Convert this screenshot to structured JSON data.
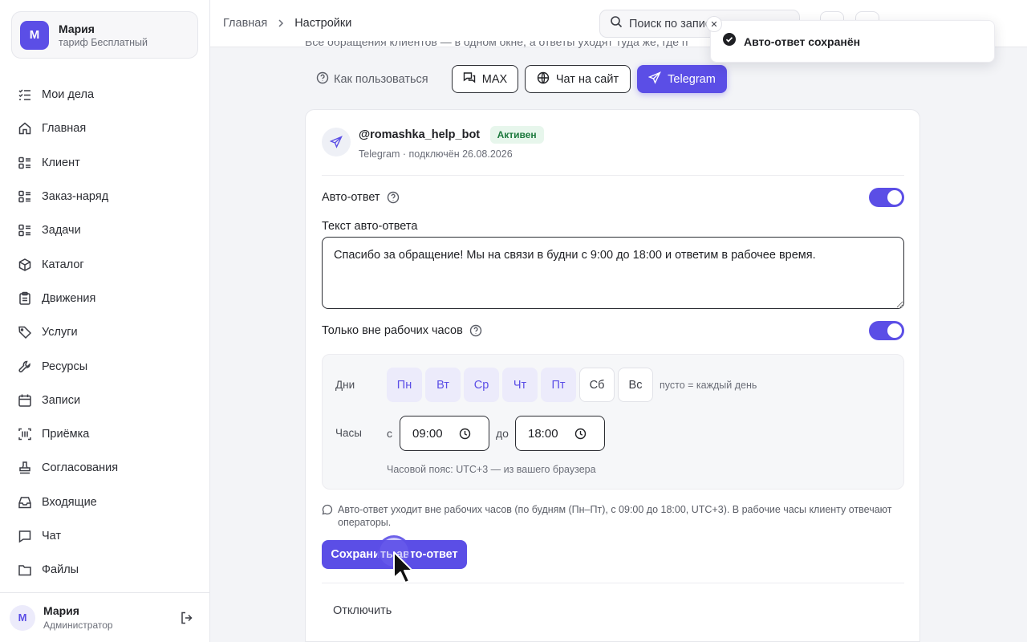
{
  "account": {
    "initial": "М",
    "name": "Мария",
    "plan": "тариф Бесплатный"
  },
  "nav": {
    "items": [
      {
        "label": "Мои дела",
        "icon": "checklist-icon"
      },
      {
        "label": "Главная",
        "icon": "home-icon"
      },
      {
        "label": "Клиент",
        "icon": "list-icon"
      },
      {
        "label": "Заказ-наряд",
        "icon": "list-icon"
      },
      {
        "label": "Задачи",
        "icon": "list-icon"
      },
      {
        "label": "Каталог",
        "icon": "box-icon"
      },
      {
        "label": "Движения",
        "icon": "clipboard-icon"
      },
      {
        "label": "Услуги",
        "icon": "tag-icon"
      },
      {
        "label": "Ресурсы",
        "icon": "wrench-icon"
      },
      {
        "label": "Записи",
        "icon": "calendar-icon"
      },
      {
        "label": "Приёмка",
        "icon": "scan-icon"
      },
      {
        "label": "Согласования",
        "icon": "stamp-icon"
      },
      {
        "label": "Входящие",
        "icon": "inbox-icon"
      },
      {
        "label": "Чат",
        "icon": "chat-icon"
      },
      {
        "label": "Файлы",
        "icon": "folder-icon"
      }
    ]
  },
  "user": {
    "initial": "М",
    "name": "Мария",
    "role": "Администратор"
  },
  "breadcrumb": {
    "home": "Главная",
    "current": "Настройки"
  },
  "search": {
    "placeholder": "Поиск по записям"
  },
  "toast": {
    "message": "Авто-ответ сохранён",
    "close": "✕"
  },
  "intro": "Все обращения клиентов — в одном окне, а ответы уходят туда же, где п",
  "channels": {
    "howto": "Как пользоваться",
    "max": "MAX",
    "site": "Чат на сайт",
    "telegram": "Telegram",
    "active": "Telegram"
  },
  "bot": {
    "name": "@romashka_help_bot",
    "status": "Активен",
    "meta": "Telegram · подключён 26.08.2026"
  },
  "autoreply": {
    "label": "Авто-ответ",
    "enabled": true,
    "text_label": "Текст авто-ответа",
    "text": "Спасибо за обращение! Мы на связи в будни с 9:00 до 18:00 и ответим в рабочее время.",
    "offhours_label": "Только вне рабочих часов",
    "offhours_enabled": true
  },
  "schedule": {
    "days_label": "Дни",
    "days": [
      {
        "label": "Пн",
        "selected": true
      },
      {
        "label": "Вт",
        "selected": true
      },
      {
        "label": "Ср",
        "selected": true
      },
      {
        "label": "Чт",
        "selected": true
      },
      {
        "label": "Пт",
        "selected": true
      },
      {
        "label": "Сб",
        "selected": false
      },
      {
        "label": "Вс",
        "selected": false
      }
    ],
    "days_hint": "пусто = каждый день",
    "hours_label": "Часы",
    "from_prep": "с",
    "from": "09:00",
    "to_prep": "до",
    "to": "18:00",
    "timezone": "Часовой пояс: UTC+3 — из вашего браузера"
  },
  "summary": "Авто-ответ уходит вне рабочих часов (по будням (Пн–Пт), с 09:00 до 18:00, UTC+3). В рабочие часы клиенту отвечают операторы.",
  "actions": {
    "save": "Сохранить авто-ответ",
    "disable": "Отключить"
  },
  "colors": {
    "accent": "#5b4ee6",
    "accent_soft": "#ecebfb",
    "success_bg": "#e7f6ec",
    "success_text": "#1d7a3e"
  }
}
